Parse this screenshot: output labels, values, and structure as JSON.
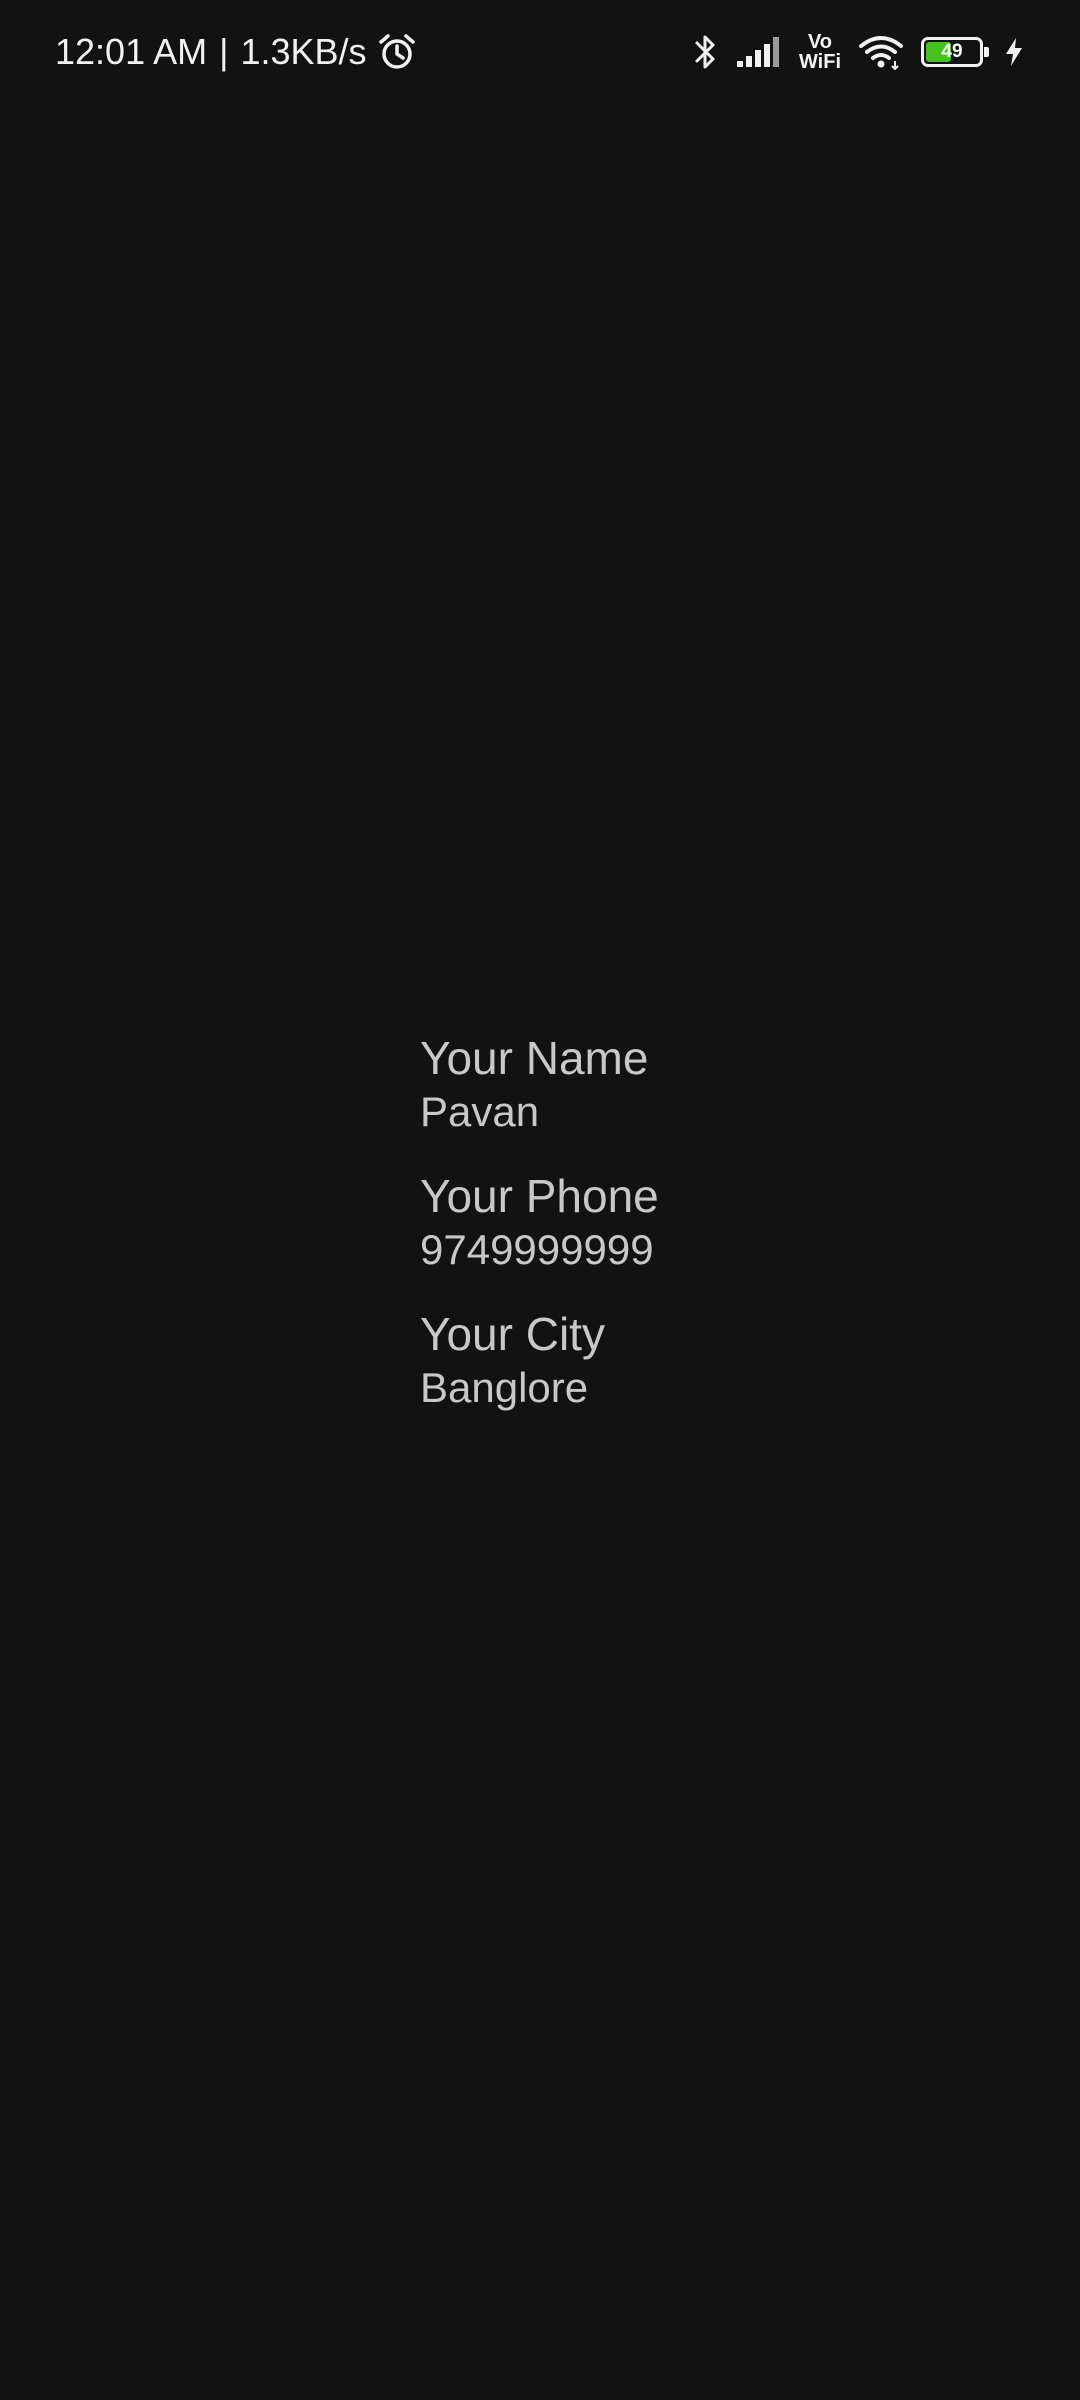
{
  "status_bar": {
    "time": "12:01 AM",
    "separator": "|",
    "network_speed": "1.3KB/s",
    "vowifi_top": "Vo",
    "vowifi_bottom": "WiFi",
    "battery_level": "49",
    "battery_fraction": 0.49,
    "battery_color": "#46c21e",
    "icons": [
      "alarm-icon",
      "bluetooth-icon",
      "signal-icon",
      "vowifi-icon",
      "wifi-icon",
      "battery-icon",
      "charging-icon"
    ]
  },
  "profile": {
    "name_label": "Your Name",
    "name_value": "Pavan",
    "phone_label": "Your Phone",
    "phone_value": "9749999999",
    "city_label": "Your City",
    "city_value": "Banglore"
  },
  "colors": {
    "background": "#121212",
    "text": "#c8c8c8"
  }
}
